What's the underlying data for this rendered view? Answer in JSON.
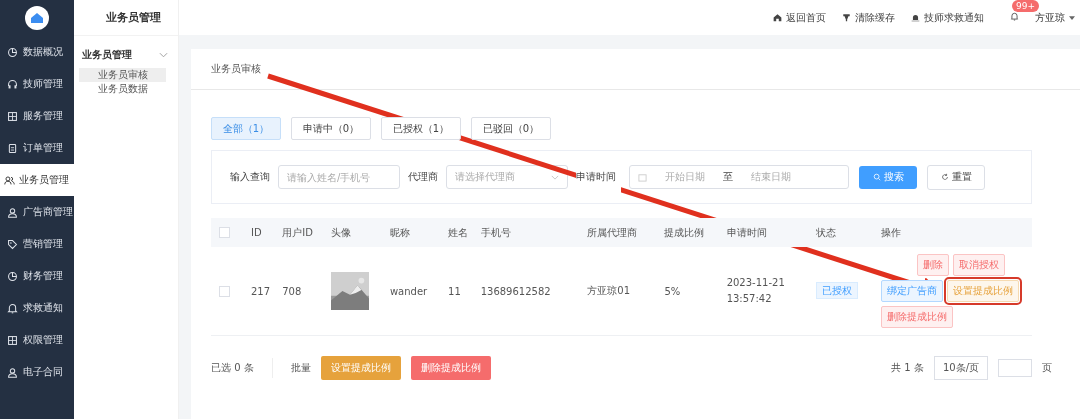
{
  "sidebar": {
    "items": [
      {
        "label": "数据概况",
        "selected": false
      },
      {
        "label": "技师管理",
        "selected": false
      },
      {
        "label": "服务管理",
        "selected": false
      },
      {
        "label": "订单管理",
        "selected": false
      },
      {
        "label": "业务员管理",
        "selected": true
      },
      {
        "label": "广告商管理",
        "selected": false
      },
      {
        "label": "营销管理",
        "selected": false
      },
      {
        "label": "财务管理",
        "selected": false
      },
      {
        "label": "求救通知",
        "selected": false
      },
      {
        "label": "权限管理",
        "selected": false
      },
      {
        "label": "电子合同",
        "selected": false
      }
    ]
  },
  "subnav": {
    "title": "业务员管理",
    "group": "业务员管理",
    "expanded": true,
    "items": [
      {
        "label": "业务员审核",
        "selected": true
      },
      {
        "label": "业务员数据",
        "selected": false
      }
    ]
  },
  "topbar": {
    "links": [
      {
        "label": "返回首页"
      },
      {
        "label": "清除缓存"
      },
      {
        "label": "技师求救通知"
      }
    ],
    "badge": "99+",
    "user": "方亚琼"
  },
  "page_title": "业务员审核",
  "tabs": [
    {
      "label": "全部（1）",
      "selected": true
    },
    {
      "label": "申请中（0）",
      "selected": false
    },
    {
      "label": "已授权（1）",
      "selected": false
    },
    {
      "label": "已驳回（0）",
      "selected": false
    }
  ],
  "filters": {
    "query_label": "输入查询",
    "query_placeholder": "请输入姓名/手机号",
    "agent_label": "代理商",
    "agent_placeholder": "请选择代理商",
    "date_label": "申请时间",
    "start_placeholder": "开始日期",
    "separator": "至",
    "end_placeholder": "结束日期",
    "search_button": "搜索",
    "reset_button": "重置"
  },
  "table": {
    "all_checked": false,
    "columns": [
      "ID",
      "用户ID",
      "头像",
      "昵称",
      "姓名",
      "手机号",
      "所属代理商",
      "提成比例",
      "申请时间",
      "状态",
      "操作"
    ],
    "rows": [
      {
        "checked": false,
        "id": "217",
        "user_id": "708",
        "avatar": {
          "kind": "picture"
        },
        "nickname": "wander",
        "name": "11",
        "phone": "13689612582",
        "agent": "方亚琼01",
        "ratio": "5%",
        "time": [
          "2023-11-21",
          "13:57:42"
        ],
        "status": "已授权",
        "actions": [
          {
            "label": "删除",
            "kind": "danger",
            "highlighted": false
          },
          {
            "label": "取消授权",
            "kind": "danger",
            "highlighted": false
          },
          {
            "label": "绑定广告商",
            "kind": "primary",
            "highlighted": false
          },
          {
            "label": "设置提成比例",
            "kind": "warning",
            "highlighted": true
          },
          {
            "label": "删除提成比例",
            "kind": "danger",
            "highlighted": false
          }
        ]
      }
    ]
  },
  "footer": {
    "selected_count": "已选 0 条",
    "batch_label": "批量",
    "batch_buttons": [
      {
        "label": "设置提成比例",
        "kind": "warning"
      },
      {
        "label": "删除提成比例",
        "kind": "danger"
      }
    ],
    "total": "共 1 条",
    "page_size": "10条/页",
    "page_suffix": "页"
  }
}
